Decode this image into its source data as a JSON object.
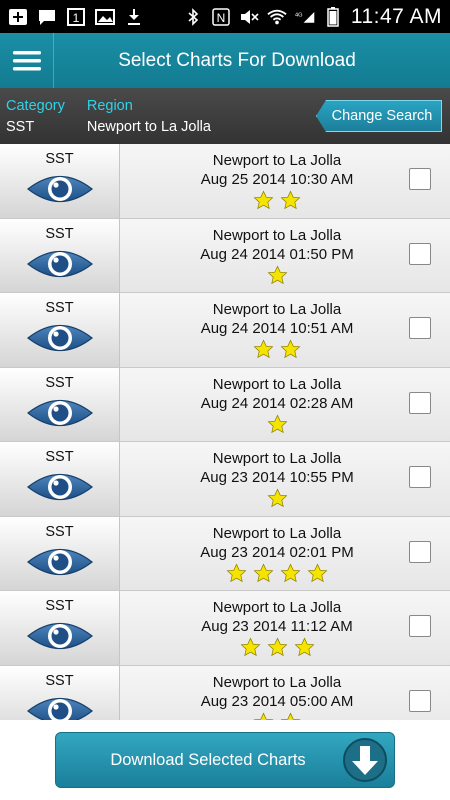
{
  "status_bar": {
    "time": "11:47 AM",
    "network": "4G",
    "notification_badge": "1"
  },
  "header": {
    "title": "Select Charts For Download",
    "menu_icon": "hamburger-menu-icon"
  },
  "search": {
    "category_label": "Category",
    "category_value": "SST",
    "region_label": "Region",
    "region_value": "Newport to La Jolla",
    "change_button": "Change Search"
  },
  "charts": [
    {
      "category": "SST",
      "region": "Newport to La Jolla",
      "date": "Aug 25 2014 10:30 AM",
      "stars": 2
    },
    {
      "category": "SST",
      "region": "Newport to La Jolla",
      "date": "Aug 24 2014 01:50 PM",
      "stars": 1
    },
    {
      "category": "SST",
      "region": "Newport to La Jolla",
      "date": "Aug 24 2014 10:51 AM",
      "stars": 2
    },
    {
      "category": "SST",
      "region": "Newport to La Jolla",
      "date": "Aug 24 2014 02:28 AM",
      "stars": 1
    },
    {
      "category": "SST",
      "region": "Newport to La Jolla",
      "date": "Aug 23 2014 10:55 PM",
      "stars": 1
    },
    {
      "category": "SST",
      "region": "Newport to La Jolla",
      "date": "Aug 23 2014 02:01 PM",
      "stars": 4
    },
    {
      "category": "SST",
      "region": "Newport to La Jolla",
      "date": "Aug 23 2014 11:12 AM",
      "stars": 3
    },
    {
      "category": "SST",
      "region": "Newport to La Jolla",
      "date": "Aug 23 2014 05:00 AM",
      "stars": 2
    }
  ],
  "footer": {
    "download_button": "Download Selected Charts"
  },
  "colors": {
    "accent": "#1a8fa6",
    "label_cyan": "#2fd2e8",
    "star_yellow": "#f5e400",
    "eye_blue": "#2b5f95"
  }
}
